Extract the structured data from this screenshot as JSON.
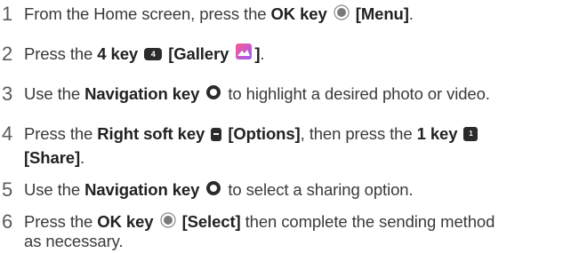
{
  "steps": [
    {
      "num": "1",
      "pre": "From the Home screen, press the ",
      "key": "OK key",
      "label": "[Menu]",
      "post": "."
    },
    {
      "num": "2",
      "pre": "Press the ",
      "key": "4 key",
      "key_glyph": "4",
      "label": "[Gallery",
      "label_end": "]",
      "post": "."
    },
    {
      "num": "3",
      "pre": "Use the ",
      "key": "Navigation key",
      "post": " to highlight a desired photo or video."
    },
    {
      "num": "4",
      "pre": "Press the ",
      "key": "Right soft key",
      "label": "[Options]",
      "mid": ", then press the ",
      "key2": "1 key",
      "key2_glyph": "1",
      "label2": "[Share]",
      "post": "."
    },
    {
      "num": "5",
      "pre": "Use the ",
      "key": "Navigation key",
      "post": " to select a sharing option."
    },
    {
      "num": "6",
      "pre": "Press the ",
      "key": "OK key",
      "label": "[Select]",
      "post": " then complete the sending method",
      "line2": "as necessary."
    }
  ],
  "icons": {
    "ok_key": "ok-key-icon",
    "four_key": "four-key-icon",
    "gallery": "gallery-app-icon",
    "nav_key": "navigation-key-icon",
    "soft_key": "right-soft-key-icon",
    "one_key": "one-key-icon"
  },
  "colors": {
    "text": "#3a3a3a",
    "bold": "#222222",
    "gallery_top": "#ff5a8a",
    "gallery_bottom": "#9b5cff"
  }
}
